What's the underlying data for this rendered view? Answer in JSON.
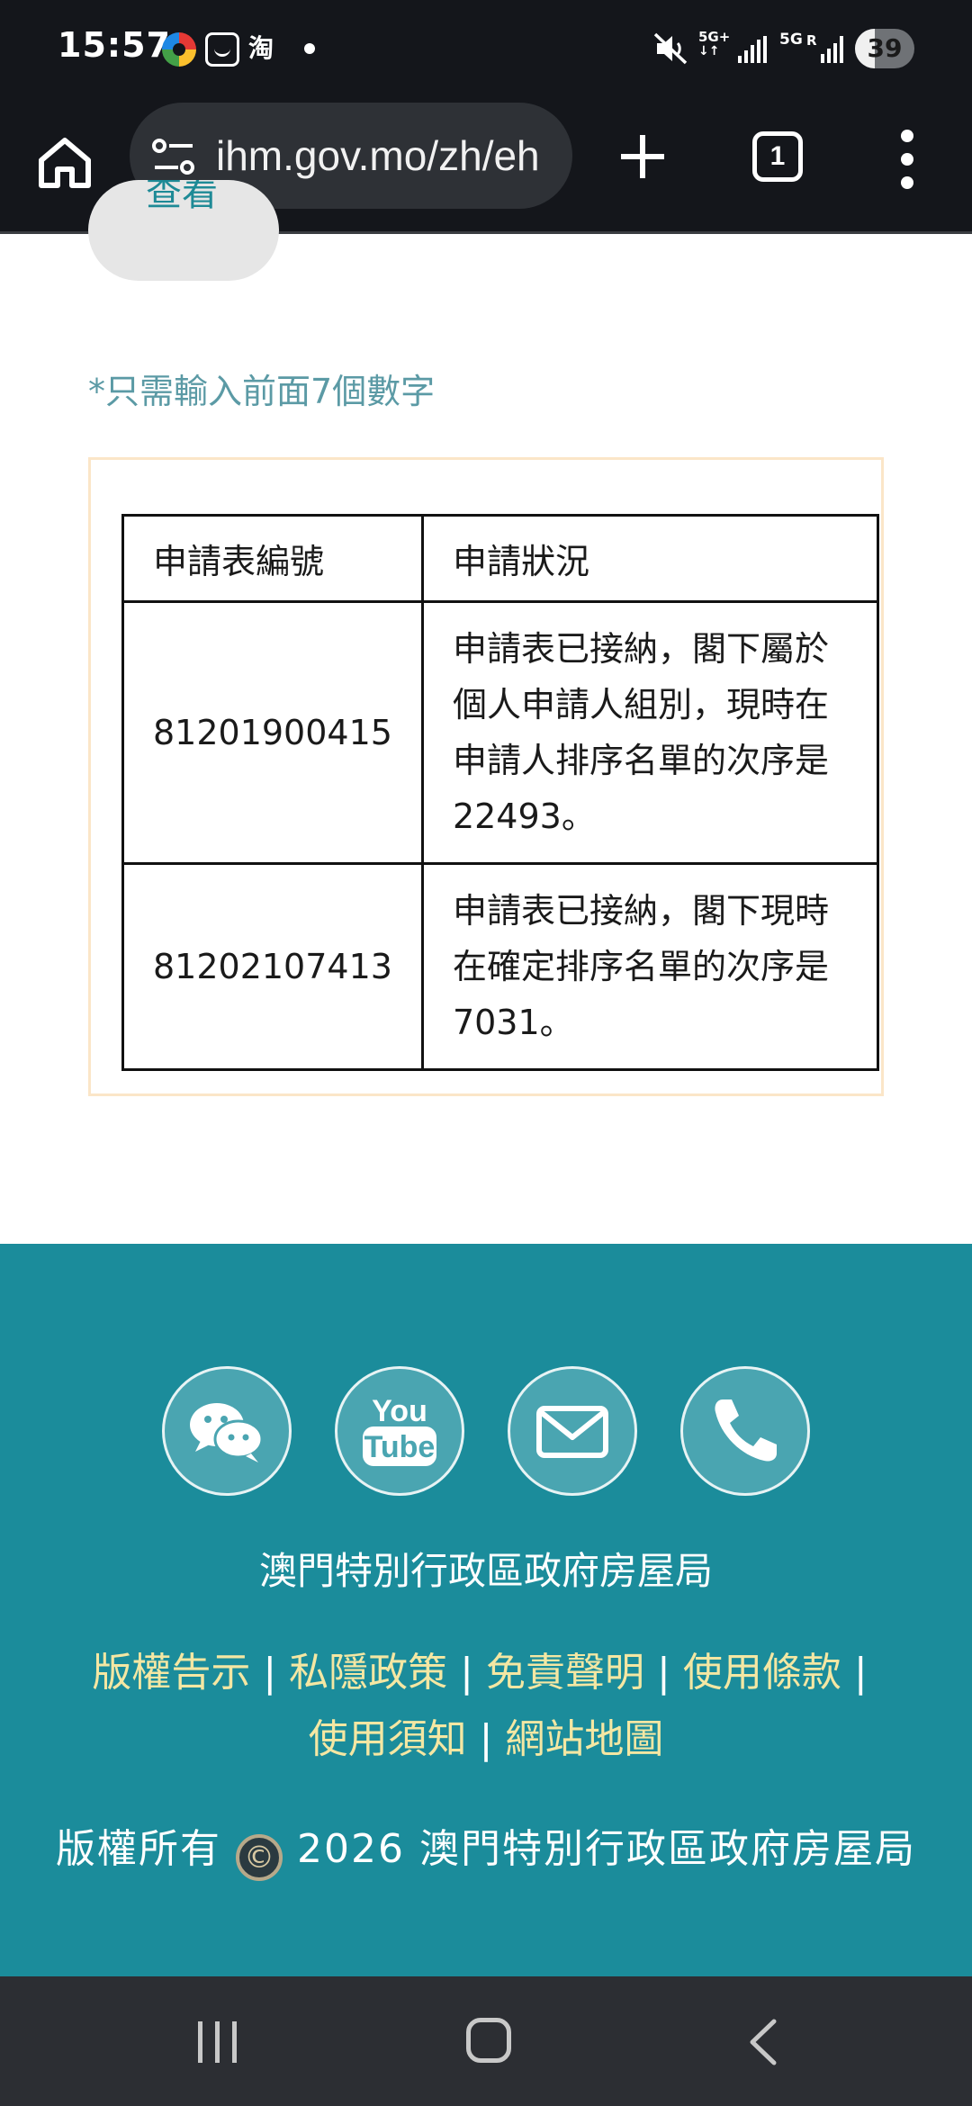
{
  "status_bar": {
    "time": "15:57",
    "taobao_glyph": "淘",
    "network_1": "5G+",
    "network_2": "5G",
    "roaming": "R",
    "battery": "39"
  },
  "browser": {
    "url": "ihm.gov.mo/zh/eh",
    "tab_count": "1",
    "icons": [
      "home-icon",
      "site-settings-icon",
      "new-tab-icon",
      "tab-switcher-icon",
      "more-menu-icon"
    ]
  },
  "page": {
    "view_button_label": "查看",
    "hint": "*只需輸入前面7個數字",
    "table": {
      "headers": [
        "申請表編號",
        "申請狀況"
      ],
      "rows": [
        {
          "number": "81201900415",
          "status": "申請表已接納，閣下屬於個人申請人組別，現時在申請人排序名單的次序是22493。"
        },
        {
          "number": "81202107413",
          "status": "申請表已接納，閣下現時在確定排序名單的次序是7031。"
        }
      ]
    }
  },
  "footer": {
    "social_icons": [
      "wechat-icon",
      "youtube-icon",
      "mail-icon",
      "phone-icon"
    ],
    "youtube_top": "You",
    "youtube_bottom": "Tube",
    "department": "澳門特別行政區政府房屋局",
    "links": [
      "版權告示",
      "私隱政策",
      "免責聲明",
      "使用條款",
      "使用須知",
      "網站地圖"
    ],
    "copyright_prefix": "版權所有",
    "copyright_symbol": "©",
    "copyright_suffix": "2026 澳門特別行政區政府房屋局"
  },
  "colors": {
    "footer_bg": "#1b8c9b",
    "link": "#f4e7a3",
    "hint": "#5b9aa5",
    "table_border": "#fbe6c8"
  }
}
